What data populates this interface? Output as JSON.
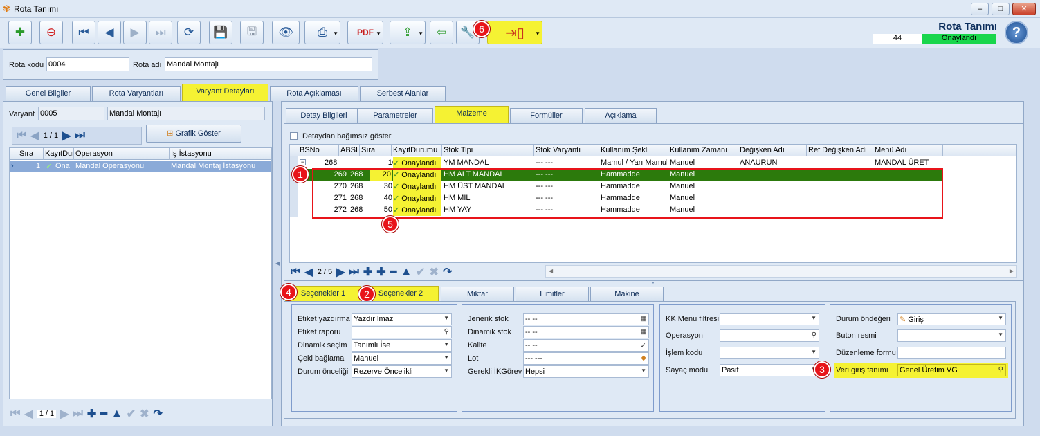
{
  "window": {
    "title": "Rota Tanımı"
  },
  "header": {
    "title": "Rota Tanımı",
    "number": "44",
    "status": "Onaylandı",
    "status_color": "#19d64c"
  },
  "form": {
    "rota_kodu_label": "Rota kodu",
    "rota_kodu": "0004",
    "rota_adi_label": "Rota adı",
    "rota_adi": "Mandal Montajı"
  },
  "main_tabs": [
    "Genel Bilgiler",
    "Rota Varyantları",
    "Varyant Detayları",
    "Rota Açıklaması",
    "Serbest Alanlar"
  ],
  "left": {
    "variant_label": "Varyant",
    "variant_code": "0005",
    "variant_name": "Mandal Montajı",
    "pager": "1 / 1",
    "graph_button": "Grafik Göster",
    "columns": [
      "Sıra",
      "KayıtDur",
      "Operasyon",
      "İş İstasyonu"
    ],
    "rows": [
      {
        "sira": "1",
        "kayit": "Ona",
        "operasyon": "Mandal Operasyonu",
        "istasyon": "Mandal Montaj İstasyonu"
      }
    ],
    "bottom_pager": "1 / 1"
  },
  "detail_tabs": [
    "Detay Bilgileri",
    "Parametreler",
    "Malzeme",
    "Formüller",
    "Açıklama"
  ],
  "material": {
    "independent_label": "Detaydan bağımsız göster",
    "columns": [
      "BSNo",
      "ABSI",
      "Sıra",
      "KayıtDurumu",
      "Stok Tipi",
      "Stok Varyantı",
      "Kullanım Şekli",
      "Kullanım Zamanı",
      "Değişken Adı",
      "Ref Değişken Adı",
      "Menü Adı"
    ],
    "parent": {
      "bsno": "268",
      "abs": "",
      "sira": "10",
      "durum": "Onaylandı",
      "stok": "YM MANDAL",
      "varyant": "--- ---",
      "sekil": "Mamul / Yarı Mamul",
      "zaman": "Manuel",
      "degisken": "ANAURUN",
      "ref": "",
      "menu": "MANDAL ÜRET"
    },
    "rows": [
      {
        "bsno": "269",
        "abs": "268",
        "sira": "20",
        "durum": "Onaylandı",
        "stok": "HM ALT MANDAL",
        "varyant": "--- ---",
        "sekil": "Hammadde",
        "zaman": "Manuel"
      },
      {
        "bsno": "270",
        "abs": "268",
        "sira": "30",
        "durum": "Onaylandı",
        "stok": "HM ÜST MANDAL",
        "varyant": "--- ---",
        "sekil": "Hammadde",
        "zaman": "Manuel"
      },
      {
        "bsno": "271",
        "abs": "268",
        "sira": "40",
        "durum": "Onaylandı",
        "stok": "HM MİL",
        "varyant": "--- ---",
        "sekil": "Hammadde",
        "zaman": "Manuel"
      },
      {
        "bsno": "272",
        "abs": "268",
        "sira": "50",
        "durum": "Onaylandı",
        "stok": "HM YAY",
        "varyant": "--- ---",
        "sekil": "Hammadde",
        "zaman": "Manuel"
      }
    ],
    "pager": "2 / 5"
  },
  "option_tabs": [
    "Seçenekler 1",
    "Seçenekler 2",
    "Miktar",
    "Limitler",
    "Makine"
  ],
  "options": {
    "g1": [
      {
        "label": "Etiket yazdırma",
        "value": "Yazdırılmaz"
      },
      {
        "label": "Etiket raporu",
        "value": ""
      },
      {
        "label": "Dinamik seçim",
        "value": "Tanımlı İse"
      },
      {
        "label": "Çeki bağlama",
        "value": "Manuel"
      },
      {
        "label": "Durum önceliği",
        "value": "Rezerve Öncelikli"
      }
    ],
    "g2": [
      {
        "label": "Jenerik stok",
        "value": "-- --"
      },
      {
        "label": "Dinamik stok",
        "value": "-- --"
      },
      {
        "label": "Kalite",
        "value": "-- --"
      },
      {
        "label": "Lot",
        "value": "--- ---"
      },
      {
        "label": "Gerekli İKGörev",
        "value": "Hepsi"
      }
    ],
    "g3": [
      {
        "label": "KK Menu filtresi",
        "value": ""
      },
      {
        "label": "Operasyon",
        "value": ""
      },
      {
        "label": "İşlem kodu",
        "value": ""
      },
      {
        "label": "Sayaç modu",
        "value": "Pasif"
      }
    ],
    "g4": [
      {
        "label": "Durum öndeğeri",
        "value": "Giriş"
      },
      {
        "label": "Buton resmi",
        "value": ""
      },
      {
        "label": "Düzenleme formu",
        "value": ""
      },
      {
        "label": "Veri giriş tanımı",
        "value": "Genel Üretim VG"
      }
    ]
  },
  "badges": [
    "1",
    "2",
    "3",
    "4",
    "5",
    "6"
  ],
  "colors": {
    "highlight": "#f5f233",
    "selected_row": "#2c7a0c",
    "annotation": "#e8141a"
  }
}
